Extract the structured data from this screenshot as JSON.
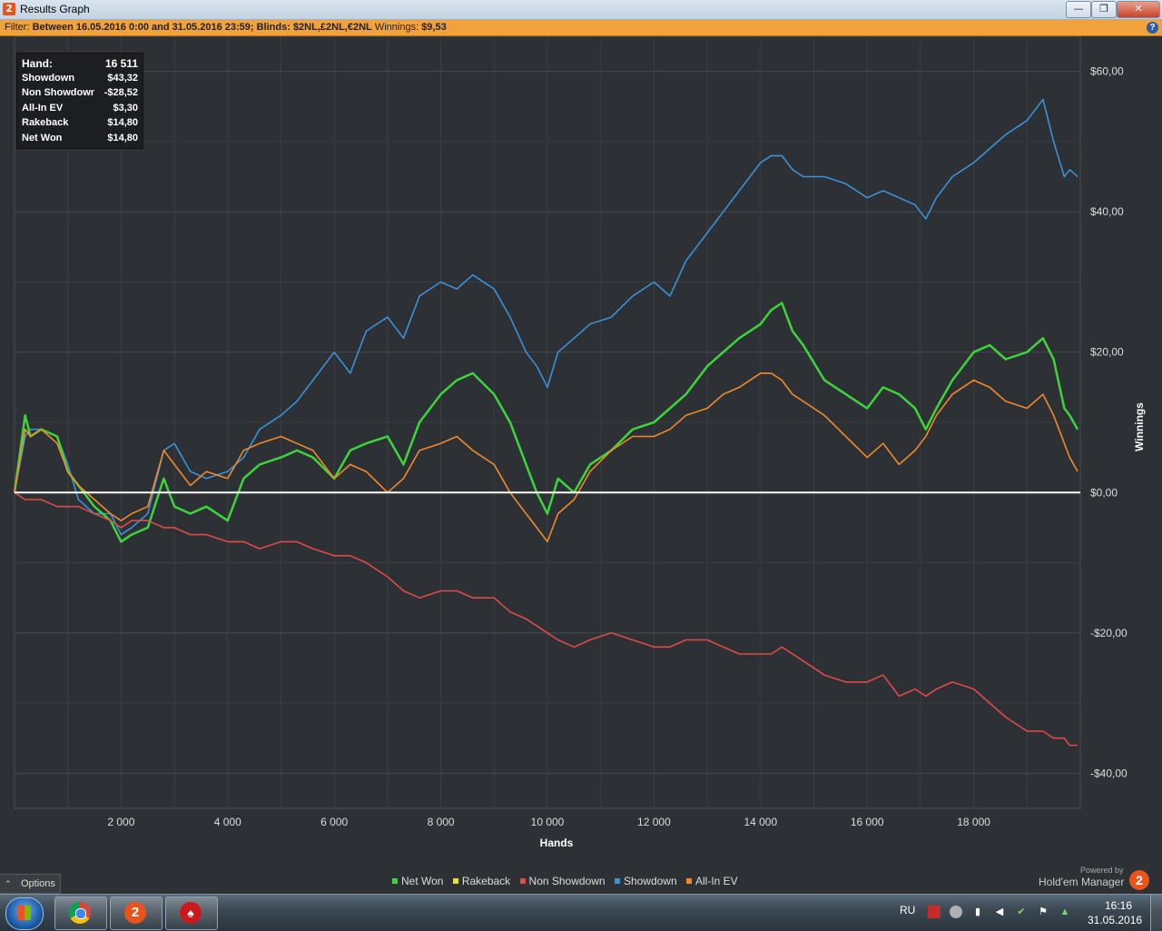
{
  "window": {
    "title": "Results Graph",
    "minimize_glyph": "—",
    "maximize_glyph": "❐",
    "close_glyph": "✕"
  },
  "filter": {
    "label": "Filter:",
    "text": "Between 16.05.2016 0:00 and 31.05.2016 23:59; Blinds: $2NL,£2NL,€2NL",
    "winnings_label": "Winnings:",
    "winnings_value": "$9,53",
    "help": "?"
  },
  "stats": [
    {
      "label": "Hand:",
      "value": "16 511"
    },
    {
      "label": "Showdown",
      "value": "$43,32"
    },
    {
      "label": "Non Showdown",
      "value": "-$28,52"
    },
    {
      "label": "All-In EV",
      "value": "$3,30"
    },
    {
      "label": "Rakeback",
      "value": "$14,80"
    },
    {
      "label": "Net Won",
      "value": "$14,80"
    }
  ],
  "options": {
    "label": "Options",
    "chevron": "⌃"
  },
  "legend": [
    {
      "name": "Net Won",
      "color": "#3cd53c"
    },
    {
      "name": "Rakeback",
      "color": "#e8e030"
    },
    {
      "name": "Non Showdown",
      "color": "#e04a4a"
    },
    {
      "name": "Showdown",
      "color": "#3a92d8"
    },
    {
      "name": "All-In EV",
      "color": "#f08a2a"
    }
  ],
  "branding": {
    "powered_by": "Powered by",
    "name": "Hold'em Manager",
    "logo": "2"
  },
  "taskbar": {
    "language": "RU",
    "time": "16:16",
    "date": "31.05.2016",
    "hm_glyph": "2",
    "ps_glyph": "♠"
  },
  "chart_data": {
    "type": "line",
    "xlabel": "Hands",
    "ylabel": "Winnings",
    "xlim": [
      0,
      20000
    ],
    "ylim": [
      -45,
      65
    ],
    "x_ticks": [
      2000,
      4000,
      6000,
      8000,
      10000,
      12000,
      14000,
      16000,
      18000
    ],
    "x_tick_labels": [
      "2 000",
      "4 000",
      "6 000",
      "8 000",
      "10 000",
      "12 000",
      "14 000",
      "16 000",
      "18 000"
    ],
    "y_ticks": [
      60,
      40,
      20,
      0,
      -20,
      -40
    ],
    "y_tick_labels": [
      "$60,00",
      "$40,00",
      "$20,00",
      "$0,00",
      "-$20,00",
      "-$40,00"
    ],
    "grid": true,
    "legend_position": "bottom-center",
    "series": [
      {
        "name": "Showdown",
        "color": "#3a92d8",
        "x": [
          0,
          200,
          300,
          500,
          800,
          1000,
          1200,
          1500,
          1800,
          2000,
          2200,
          2500,
          2800,
          3000,
          3300,
          3600,
          4000,
          4300,
          4600,
          5000,
          5300,
          5600,
          6000,
          6300,
          6600,
          7000,
          7300,
          7600,
          8000,
          8300,
          8600,
          9000,
          9300,
          9600,
          9800,
          10000,
          10200,
          10500,
          10800,
          11200,
          11600,
          12000,
          12300,
          12600,
          13000,
          13300,
          13600,
          14000,
          14200,
          14400,
          14600,
          14800,
          15200,
          15600,
          16000,
          16300,
          16600,
          16900,
          17100,
          17300,
          17600,
          18000,
          18300,
          18600,
          19000,
          19300,
          19500,
          19700,
          19800,
          19950
        ],
        "y": [
          0,
          8,
          9,
          9,
          8,
          4,
          -1,
          -3,
          -3,
          -6,
          -5,
          -3,
          6,
          7,
          3,
          2,
          3,
          5,
          9,
          11,
          13,
          16,
          20,
          17,
          23,
          25,
          22,
          28,
          30,
          29,
          31,
          29,
          25,
          20,
          18,
          15,
          20,
          22,
          24,
          25,
          28,
          30,
          28,
          33,
          37,
          40,
          43,
          47,
          48,
          48,
          46,
          45,
          45,
          44,
          42,
          43,
          42,
          41,
          39,
          42,
          45,
          47,
          49,
          51,
          53,
          56,
          50,
          45,
          46,
          45
        ]
      },
      {
        "name": "Net Won",
        "color": "#3cd53c",
        "x": [
          0,
          200,
          300,
          500,
          800,
          1000,
          1200,
          1500,
          1800,
          2000,
          2200,
          2500,
          2800,
          3000,
          3300,
          3600,
          4000,
          4300,
          4600,
          5000,
          5300,
          5600,
          6000,
          6300,
          6600,
          7000,
          7300,
          7600,
          8000,
          8300,
          8600,
          9000,
          9300,
          9600,
          9800,
          10000,
          10200,
          10500,
          10800,
          11200,
          11600,
          12000,
          12300,
          12600,
          13000,
          13300,
          13600,
          14000,
          14200,
          14400,
          14600,
          14800,
          15200,
          15600,
          16000,
          16300,
          16600,
          16900,
          17100,
          17300,
          17600,
          18000,
          18300,
          18600,
          19000,
          19300,
          19500,
          19700,
          19800,
          19950
        ],
        "y": [
          0,
          11,
          8,
          9,
          8,
          3,
          1,
          -2,
          -4,
          -7,
          -6,
          -5,
          2,
          -2,
          -3,
          -2,
          -4,
          2,
          4,
          5,
          6,
          5,
          2,
          6,
          7,
          8,
          4,
          10,
          14,
          16,
          17,
          14,
          10,
          4,
          0,
          -3,
          2,
          0,
          4,
          6,
          9,
          10,
          12,
          14,
          18,
          20,
          22,
          24,
          26,
          27,
          23,
          21,
          16,
          14,
          12,
          15,
          14,
          12,
          9,
          12,
          16,
          20,
          21,
          19,
          20,
          22,
          19,
          12,
          11,
          9
        ]
      },
      {
        "name": "All-In EV",
        "color": "#f08a2a",
        "x": [
          0,
          200,
          300,
          500,
          800,
          1000,
          1200,
          1500,
          1800,
          2000,
          2200,
          2500,
          2800,
          3000,
          3300,
          3600,
          4000,
          4300,
          4600,
          5000,
          5300,
          5600,
          6000,
          6300,
          6600,
          7000,
          7300,
          7600,
          8000,
          8300,
          8600,
          9000,
          9300,
          9600,
          9800,
          10000,
          10200,
          10500,
          10800,
          11200,
          11600,
          12000,
          12300,
          12600,
          13000,
          13300,
          13600,
          14000,
          14200,
          14400,
          14600,
          14800,
          15200,
          15600,
          16000,
          16300,
          16600,
          16900,
          17100,
          17300,
          17600,
          18000,
          18300,
          18600,
          19000,
          19300,
          19500,
          19700,
          19800,
          19950
        ],
        "y": [
          0,
          9,
          8,
          9,
          7,
          3,
          1,
          -1,
          -3,
          -4,
          -3,
          -2,
          6,
          4,
          1,
          3,
          2,
          6,
          7,
          8,
          7,
          6,
          2,
          4,
          3,
          0,
          2,
          6,
          7,
          8,
          6,
          4,
          0,
          -3,
          -5,
          -7,
          -3,
          -1,
          3,
          6,
          8,
          8,
          9,
          11,
          12,
          14,
          15,
          17,
          17,
          16,
          14,
          13,
          11,
          8,
          5,
          7,
          4,
          6,
          8,
          11,
          14,
          16,
          15,
          13,
          12,
          14,
          11,
          7,
          5,
          3
        ]
      },
      {
        "name": "Non Showdown",
        "color": "#e04a4a",
        "x": [
          0,
          200,
          300,
          500,
          800,
          1000,
          1200,
          1500,
          1800,
          2000,
          2200,
          2500,
          2800,
          3000,
          3300,
          3600,
          4000,
          4300,
          4600,
          5000,
          5300,
          5600,
          6000,
          6300,
          6600,
          7000,
          7300,
          7600,
          8000,
          8300,
          8600,
          9000,
          9300,
          9600,
          9800,
          10000,
          10200,
          10500,
          10800,
          11200,
          11600,
          12000,
          12300,
          12600,
          13000,
          13300,
          13600,
          14000,
          14200,
          14400,
          14600,
          14800,
          15200,
          15600,
          16000,
          16300,
          16600,
          16900,
          17100,
          17300,
          17600,
          18000,
          18300,
          18600,
          19000,
          19300,
          19500,
          19700,
          19800,
          19950
        ],
        "y": [
          0,
          -1,
          -1,
          -1,
          -2,
          -2,
          -2,
          -3,
          -4,
          -5,
          -4,
          -4,
          -5,
          -5,
          -6,
          -6,
          -7,
          -7,
          -8,
          -7,
          -7,
          -8,
          -9,
          -9,
          -10,
          -12,
          -14,
          -15,
          -14,
          -14,
          -15,
          -15,
          -17,
          -18,
          -19,
          -20,
          -21,
          -22,
          -21,
          -20,
          -21,
          -22,
          -22,
          -21,
          -21,
          -22,
          -23,
          -23,
          -23,
          -22,
          -23,
          -24,
          -26,
          -27,
          -27,
          -26,
          -29,
          -28,
          -29,
          -28,
          -27,
          -28,
          -30,
          -32,
          -34,
          -34,
          -35,
          -35,
          -36,
          -36
        ]
      }
    ],
    "baseline_y": 0
  }
}
